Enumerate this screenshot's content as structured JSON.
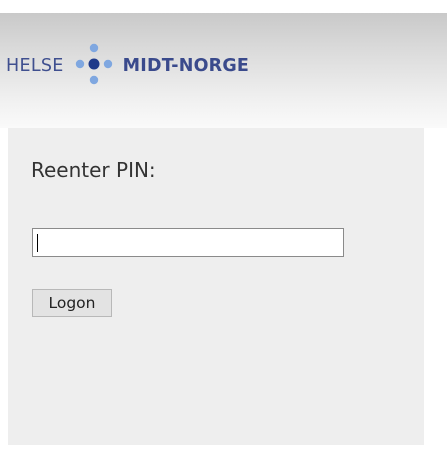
{
  "header": {
    "logo": {
      "text_left": "HELSE",
      "text_right": "MIDT-NORGE",
      "mark_icon": "four-dots-cross-icon",
      "colors": {
        "text": "#3a4a8c",
        "dot_dark": "#1f3a8a",
        "dot_light": "#7fa7e0"
      }
    }
  },
  "form": {
    "title": "Reenter PIN:",
    "pin_field": {
      "value": "",
      "placeholder": ""
    },
    "logon_label": "Logon"
  },
  "colors": {
    "panel_background": "#eeeeee",
    "header_gradient_top": "#c9c9c9",
    "header_gradient_bottom": "#fafafa"
  }
}
